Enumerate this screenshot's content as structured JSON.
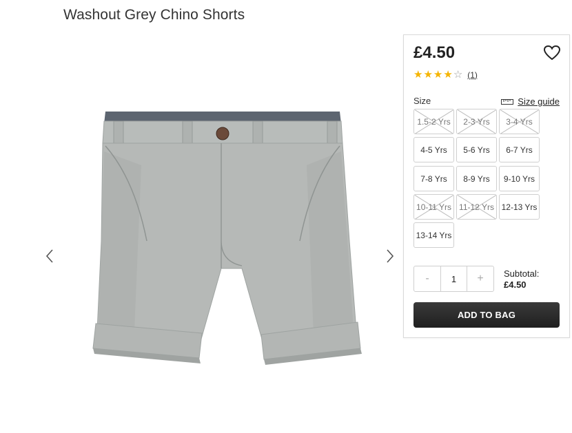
{
  "product": {
    "title": "Washout Grey Chino Shorts",
    "price": "£4.50",
    "rating": {
      "stars": 4,
      "max": 5,
      "review_count": "(1)"
    }
  },
  "sizes": {
    "label": "Size",
    "guide_label": "Size guide",
    "options": [
      {
        "label": "1.5-2 Yrs",
        "available": false
      },
      {
        "label": "2-3 Yrs",
        "available": false
      },
      {
        "label": "3-4 Yrs",
        "available": false
      },
      {
        "label": "4-5 Yrs",
        "available": true
      },
      {
        "label": "5-6 Yrs",
        "available": true
      },
      {
        "label": "6-7 Yrs",
        "available": true
      },
      {
        "label": "7-8 Yrs",
        "available": true
      },
      {
        "label": "8-9 Yrs",
        "available": true
      },
      {
        "label": "9-10 Yrs",
        "available": true
      },
      {
        "label": "10-11 Yrs",
        "available": false
      },
      {
        "label": "11-12 Yrs",
        "available": false
      },
      {
        "label": "12-13 Yrs",
        "available": true
      },
      {
        "label": "13-14 Yrs",
        "available": true
      }
    ]
  },
  "quantity": {
    "minus": "-",
    "value": "1",
    "plus": "+"
  },
  "subtotal": {
    "label": "Subtotal:",
    "value": "£4.50"
  },
  "cart": {
    "add_label": "ADD TO BAG"
  },
  "icons": {
    "prev": "chevron-left-icon",
    "next": "chevron-right-icon",
    "wishlist": "heart-icon",
    "size_guide": "ruler-icon"
  },
  "colors": {
    "star": "#f5b400",
    "button": "#222222",
    "shorts": "#b6b9b7"
  }
}
